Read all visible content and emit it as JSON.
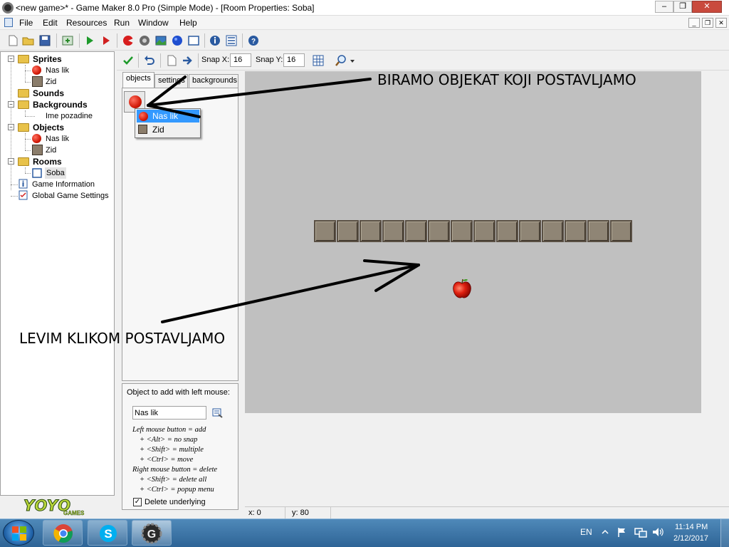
{
  "window": {
    "title": "<new game>* - Game Maker 8.0 Pro (Simple Mode) - [Room Properties: Soba]",
    "controls": [
      "–",
      "❐",
      "✕"
    ]
  },
  "menu": [
    "File",
    "Edit",
    "Resources",
    "Run",
    "Window",
    "Help"
  ],
  "toolbar_icons": [
    "new-icon",
    "open-icon",
    "save-icon",
    "create-executable-icon",
    "run-icon",
    "run-debug-icon",
    "add-sprite-icon",
    "add-sound-icon",
    "add-background-icon",
    "add-object-icon",
    "add-room-icon",
    "game-information-icon",
    "global-settings-icon",
    "help-icon"
  ],
  "tree": {
    "sprites": {
      "label": "Sprites",
      "items": [
        "Nas lik",
        "Zid"
      ]
    },
    "sounds": {
      "label": "Sounds"
    },
    "backgrounds": {
      "label": "Backgrounds",
      "items": [
        "Ime pozadine"
      ]
    },
    "objects": {
      "label": "Objects",
      "items": [
        "Nas lik",
        "Zid"
      ]
    },
    "rooms": {
      "label": "Rooms",
      "items": [
        "Soba"
      ]
    },
    "game_info": "Game Information",
    "global_settings": "Global Game Settings"
  },
  "logo": {
    "main": "YOYO",
    "sub": "GAMES"
  },
  "room_toolbar": {
    "snap_x_label": "Snap X:",
    "snap_x": "16",
    "snap_y_label": "Snap Y:",
    "snap_y": "16"
  },
  "tabs": [
    "objects",
    "settings",
    "backgrounds"
  ],
  "popup_menu": [
    "Nas lik",
    "Zid"
  ],
  "object_panel": {
    "title": "Object to add with left mouse:",
    "selected": "Nas lik",
    "help": [
      "Left mouse button = add",
      "+ <Alt> = no snap",
      "+ <Shift> = multiple",
      "+ <Ctrl> = move",
      "Right mouse button = delete",
      "+ <Shift> = delete all",
      "+ <Ctrl> = popup menu"
    ],
    "delete_underlying": "Delete underlying",
    "delete_underlying_checked": true
  },
  "status": {
    "x": "x: 0",
    "y": "y: 80"
  },
  "annotations": {
    "top": "BIRAMO OBJEKAT KOJI POSTAVLJAMO",
    "bottom": "LEVIM KLIKOM POSTAVLJAMO"
  },
  "room": {
    "wall_block_count": 14
  },
  "taskbar": {
    "lang": "EN",
    "time": "11:14 PM",
    "date": "2/12/2017"
  }
}
